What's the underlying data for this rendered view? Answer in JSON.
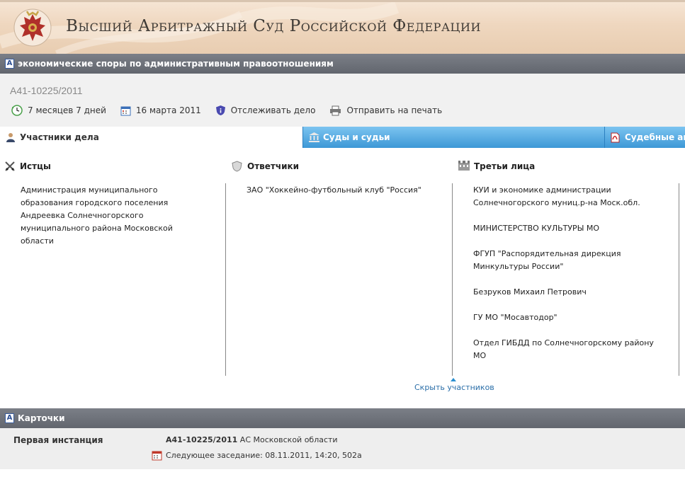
{
  "header": {
    "title": "Высший Арбитражный Суд Российской Федерации"
  },
  "category_bar": {
    "label": "экономические споры по административным правоотношениям"
  },
  "case": {
    "number": "А41-10225/2011",
    "duration": "7 месяцев 7 дней",
    "date": "16 марта 2011",
    "track_label": "Отслеживать дело",
    "print_label": "Отправить на печать"
  },
  "tabs": [
    {
      "label": "Участники дела"
    },
    {
      "label": "Суды и судьи"
    },
    {
      "label": "Судебные акты"
    }
  ],
  "participants": {
    "plaintiffs": {
      "title": "Истцы",
      "items": [
        "Администрация муниципального образования городского поселения Андреевка Солнечногорского муниципального района Московской области"
      ]
    },
    "defendants": {
      "title": "Ответчики",
      "items": [
        "ЗАО \"Хоккейно-футбольный клуб \"Россия\""
      ]
    },
    "third_parties": {
      "title": "Третьи лица",
      "items": [
        "КУИ и экономике администрации Солнечногорского муниц.р-на Моск.обл.",
        "МИНИСТЕРСТВО КУЛЬТУРЫ МО",
        "ФГУП \"Распорядительная дирекция Минкультуры России\"",
        "Безруков Михаил Петрович",
        "ГУ МО \"Мосавтодор\"",
        "Отдел ГИБДД по Солнечногорскому району МО"
      ]
    },
    "hide_link": "Скрыть участников"
  },
  "cards": {
    "title": "Карточки",
    "instance_label": "Первая инстанция",
    "case_number": "А41-10225/2011",
    "court": "АС Московской области",
    "next_session": "Следующее заседание: 08.11.2011, 14:20, 502а"
  },
  "colors": {
    "tab_blue": "#5aa9dc",
    "section_bar": "#6b6f77",
    "link": "#2a6ea8"
  }
}
